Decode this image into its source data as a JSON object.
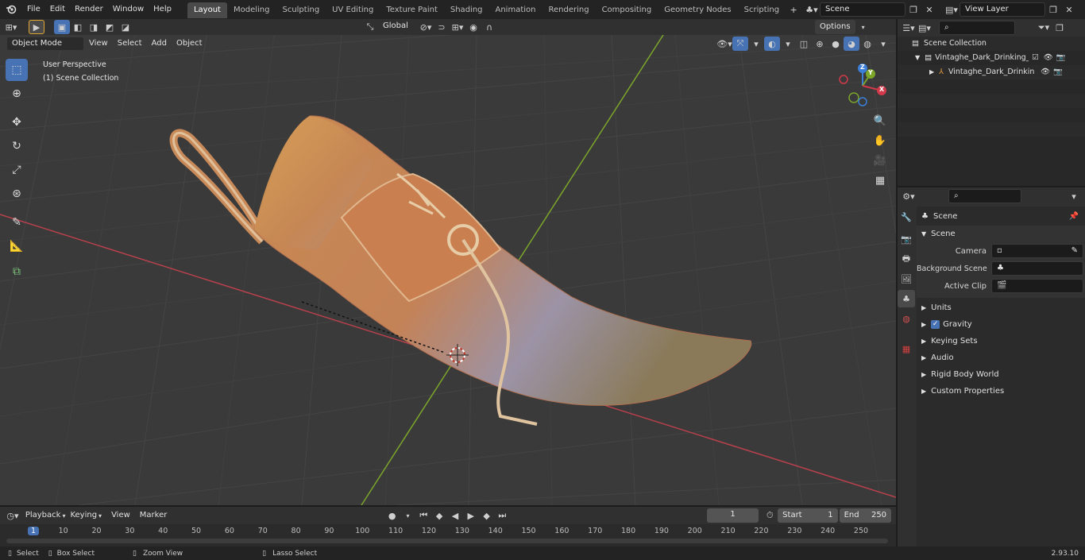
{
  "top_menu": {
    "items": [
      "File",
      "Edit",
      "Render",
      "Window",
      "Help"
    ],
    "workspaces": [
      "Layout",
      "Modeling",
      "Sculpting",
      "UV Editing",
      "Texture Paint",
      "Shading",
      "Animation",
      "Rendering",
      "Compositing",
      "Geometry Nodes",
      "Scripting"
    ],
    "active_workspace": "Layout",
    "add_tab": "+",
    "scene_field": "Scene",
    "view_layer_field": "View Layer"
  },
  "viewport_header": {
    "mode": "Object Mode",
    "menus": [
      "View",
      "Select",
      "Add",
      "Object"
    ],
    "transform_orientation": "Global",
    "options_label": "Options"
  },
  "viewport": {
    "perspective_label": "User Perspective",
    "collection_label": "(1) Scene Collection",
    "gizmo_axes": {
      "x": "X",
      "y": "Y",
      "z": "Z"
    },
    "colors": {
      "grid_bg": "#3a3a3a",
      "x_axis": "#b8414d",
      "y_axis": "#7ba62a",
      "model_orange": "#c8804a",
      "model_beige": "#d6b48d",
      "model_lavender": "#a79aa8"
    }
  },
  "toolbar_icons": [
    "select-box-icon",
    "cursor-icon",
    "move-icon",
    "rotate-icon",
    "scale-icon",
    "transform-icon",
    "annotate-icon",
    "measure-icon",
    "add-cube-icon"
  ],
  "outliner": {
    "root": "Scene Collection",
    "collection": "Vintaghe_Dark_Drinking_Horn",
    "object": "Vintaghe_Dark_Drinking_"
  },
  "properties": {
    "context_title": "Scene",
    "panel_title": "Scene",
    "camera_label": "Camera",
    "background_scene_label": "Background Scene",
    "active_clip_label": "Active Clip",
    "subpanels": [
      "Units",
      "Gravity",
      "Keying Sets",
      "Audio",
      "Rigid Body World",
      "Custom Properties"
    ],
    "gravity_enabled": true
  },
  "timeline": {
    "menus": [
      "Playback",
      "Keying",
      "View",
      "Marker"
    ],
    "current_frame": "1",
    "start_label": "Start",
    "start_value": "1",
    "end_label": "End",
    "end_value": "250",
    "ruler": [
      "1",
      "10",
      "20",
      "30",
      "40",
      "50",
      "60",
      "70",
      "80",
      "90",
      "100",
      "110",
      "120",
      "130",
      "140",
      "150",
      "160",
      "170",
      "180",
      "190",
      "200",
      "210",
      "220",
      "230",
      "240",
      "250"
    ]
  },
  "statusbar": {
    "select": "Select",
    "box_select": "Box Select",
    "zoom_view": "Zoom View",
    "lasso_select": "Lasso Select",
    "version": "2.93.10"
  }
}
